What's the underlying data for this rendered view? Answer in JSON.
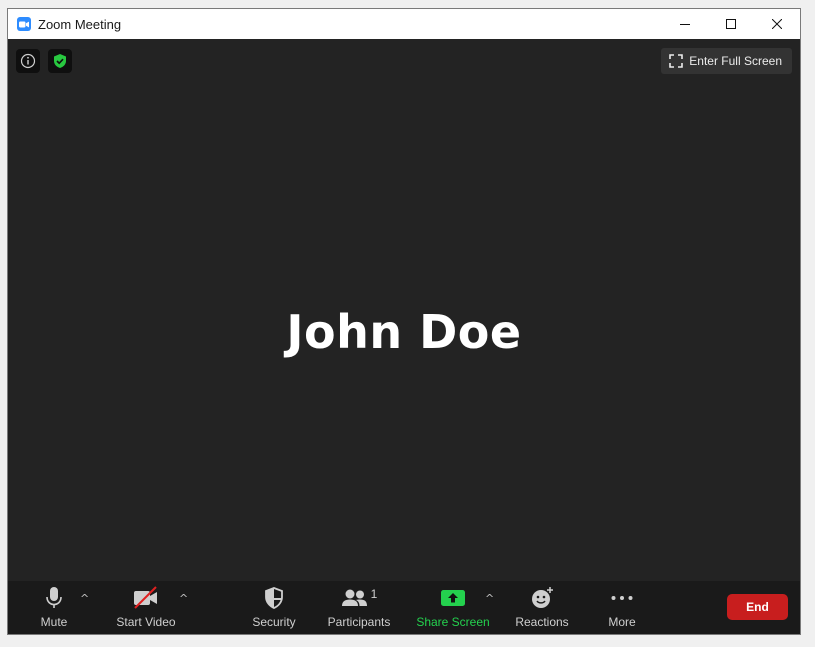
{
  "window": {
    "title": "Zoom Meeting"
  },
  "top_bar": {
    "fullscreen_label": "Enter Full Screen"
  },
  "stage": {
    "participant_name": "John Doe"
  },
  "toolbar": {
    "mute_label": "Mute",
    "start_video_label": "Start Video",
    "security_label": "Security",
    "participants_label": "Participants",
    "participants_count": "1",
    "share_screen_label": "Share Screen",
    "reactions_label": "Reactions",
    "more_label": "More",
    "end_label": "End",
    "caret_glyph": "^"
  },
  "colors": {
    "stage_background": "#232323",
    "toolbar_background": "#1a1a1a",
    "share_green": "#24d14e",
    "end_red": "#c81e1e",
    "zoom_blue": "#2d8cff",
    "shield_green": "#28c840",
    "video_off_red": "#e02020"
  },
  "icons": [
    "zoom-app-icon",
    "minimize-icon",
    "maximize-icon",
    "close-icon",
    "info-icon",
    "shield-check-icon",
    "fullscreen-icon",
    "microphone-icon",
    "video-off-icon",
    "security-shield-icon",
    "participants-icon",
    "share-screen-icon",
    "reactions-icon",
    "more-dots-icon",
    "chevron-up-icon"
  ]
}
